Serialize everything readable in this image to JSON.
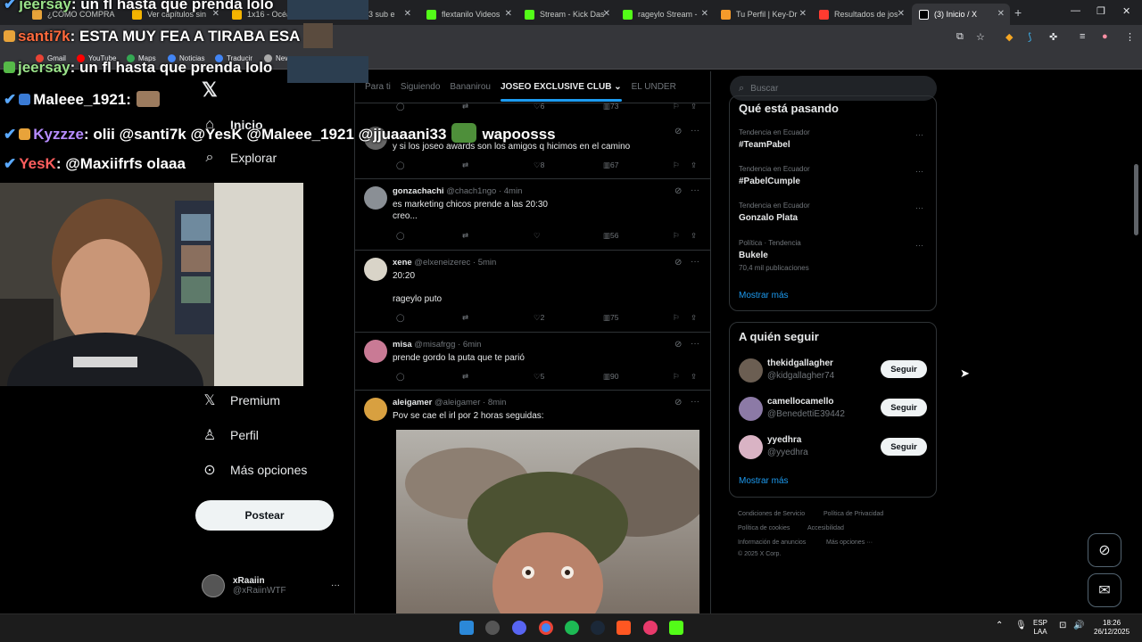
{
  "browser": {
    "tabs": [
      {
        "title": "¿CÓMO COMPRA",
        "color": "#e8a33a"
      },
      {
        "title": "Ver capítulos sin",
        "color": "#f5b400"
      },
      {
        "title": "1x16 - Océano",
        "color": "#f5b400"
      },
      {
        "title": "3 sub e",
        "color": "#d33"
      },
      {
        "title": "flextanilo Videos",
        "color": "#53fc18"
      },
      {
        "title": "Stream - Kick Das",
        "color": "#53fc18"
      },
      {
        "title": "rageylo Stream -",
        "color": "#53fc18"
      },
      {
        "title": "Tu Perfil | Key-Dr",
        "color": "#f59b2b"
      },
      {
        "title": "Resultados de jos",
        "color": "#ff0000"
      },
      {
        "title": "(3) Inicio / X",
        "color": "#ffffff"
      }
    ],
    "bookmarks": [
      {
        "label": "Gmail",
        "color": "#ea4335"
      },
      {
        "label": "YouTube",
        "color": "#ff0000"
      },
      {
        "label": "Maps",
        "color": "#34a853"
      },
      {
        "label": "Noticias",
        "color": "#4285f4"
      },
      {
        "label": "Traducir",
        "color": "#4285f4"
      },
      {
        "label": "New",
        "color": "#aaaaaa"
      }
    ]
  },
  "chat": {
    "lines": [
      {
        "user": "jeersay",
        "text": ": un fl hasta que prenda lolo"
      },
      {
        "user": "santi7k",
        "text": ": ESTA MUY FEA A TIRABA ESA"
      },
      {
        "user": "jeersay",
        "text": ": un fl hasta que prenda lolo"
      },
      {
        "user": "Maleee_1921",
        "text": ":"
      },
      {
        "user": "Kyzzze",
        "text": ": olii @santi7k @YesK @Maleee_1921 @jjuaaani33"
      },
      {
        "user": "YesK",
        "text": ": @Maxiifrfs olaaa"
      }
    ],
    "extra_word": "wapoosss"
  },
  "nav": {
    "home": "Inicio",
    "explore": "Explorar",
    "premium": "Premium",
    "profile": "Perfil",
    "more": "Más opciones",
    "post_button": "Postear",
    "account_name": "xRaaiin",
    "account_handle": "@xRaiinWTF",
    "account_more": "···"
  },
  "feed": {
    "tabs": [
      "Para ti",
      "Siguiendo",
      "Bananirou",
      "JOSEO EXCLUSIVE CLUB",
      "EL UNDER"
    ],
    "top_stats": {
      "comments": "6",
      "views": "73"
    },
    "tweets": [
      {
        "name": "",
        "handle": "",
        "time": "",
        "text": "y si los joseo awards son los amigos q hicimos en el camino",
        "replies": "",
        "likes": "8",
        "views": "67",
        "color": "#666"
      },
      {
        "name": "gonzachachi",
        "handle": "@chach1ngo",
        "time": "· 4min",
        "text": "es marketing chicos prende a las 20:30\ncreo...",
        "replies": "",
        "likes": "",
        "views": "56",
        "color": "#8a8f95"
      },
      {
        "name": "xene",
        "handle": "@elxeneizerec",
        "time": "· 5min",
        "text": "20:20\n\n rageylo puto",
        "replies": "",
        "likes": "2",
        "views": "75",
        "color": "#d9d4c8"
      },
      {
        "name": "misa",
        "handle": "@misafrgg",
        "time": "· 6min",
        "text": "prende gordo la puta que te parió",
        "replies": "",
        "likes": "5",
        "views": "90",
        "color": "#c97a95"
      },
      {
        "name": "aleigamer",
        "handle": "@aleigamer",
        "time": "· 8min",
        "text": "Pov se cae el irl por 2 horas seguidas:",
        "color": "#d8a040"
      }
    ]
  },
  "right": {
    "search_placeholder": "Buscar",
    "trends_title": "Qué está pasando",
    "trends": [
      {
        "meta": "Tendencia en Ecuador",
        "title": "#TeamPabel",
        "count": ""
      },
      {
        "meta": "Tendencia en Ecuador",
        "title": "#PabelCumple",
        "count": ""
      },
      {
        "meta": "Tendencia en Ecuador",
        "title": "Gonzalo Plata",
        "count": ""
      },
      {
        "meta": "Política · Tendencia",
        "title": "Bukele",
        "count": "70,4 mil publicaciones"
      }
    ],
    "trends_more": "Mostrar más",
    "follow_title": "A quién seguir",
    "suggestions": [
      {
        "name": "thekidgallagher",
        "handle": "@kidgallagher74",
        "button": "Seguir",
        "color": "#6b5e52"
      },
      {
        "name": "camellocamello",
        "handle": "@BenedettiE39442",
        "button": "Seguir",
        "color": "#8c7aa6"
      },
      {
        "name": "yyedhra",
        "handle": "@yyedhra",
        "button": "Seguir",
        "color": "#d9b3c4"
      }
    ],
    "follow_more": "Mostrar más",
    "footer": [
      "Condiciones de Servicio",
      "Política de Privacidad",
      "Política de cookies",
      "Accesibilidad",
      "Información de anuncios",
      "Más opciones ···",
      "© 2025 X Corp."
    ]
  },
  "taskbar": {
    "lang_top": "ESP",
    "lang_bottom": "LAA",
    "time": "18:26",
    "date": "26/12/2025"
  },
  "colors": {
    "accent": "#1d9bf0",
    "background": "#000000",
    "border": "#2f3336"
  }
}
